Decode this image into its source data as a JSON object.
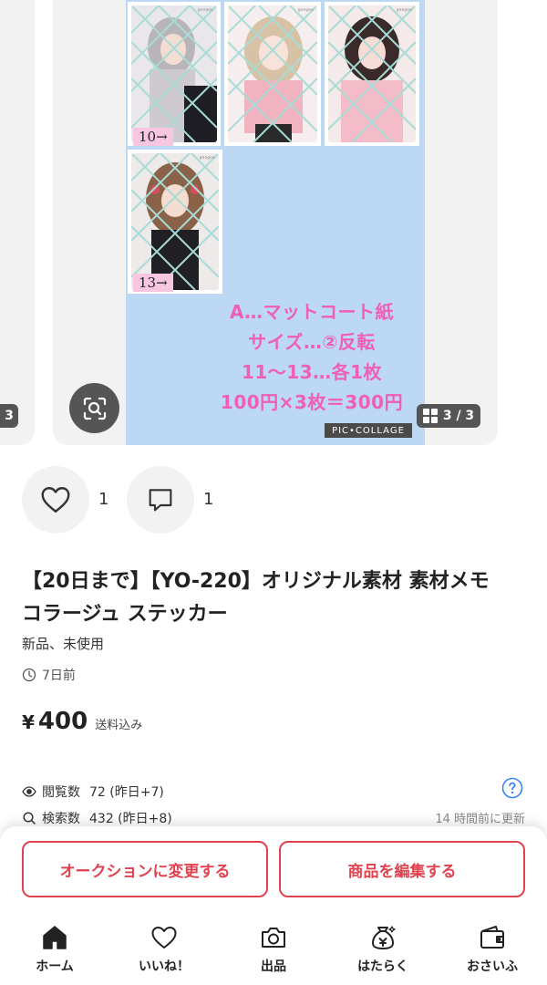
{
  "carousel": {
    "prev_counter": "3",
    "page_counter": "3 / 3",
    "collage": {
      "tags": [
        "10→",
        "13→"
      ],
      "caption_lines": [
        "A…マットコート紙",
        "サイズ…②反転",
        "11〜13…各1枚",
        "100円×3枚＝300円"
      ],
      "logo": "PIC•COLLAGE"
    }
  },
  "reactions": {
    "likes": "1",
    "comments": "1"
  },
  "product": {
    "title_line1": "【20日まで】【YO-220】オリジナル素材 素材メモ",
    "title_line2": "コラージュ ステッカー",
    "condition": "新品、未使用",
    "posted": "7日前",
    "currency": "¥",
    "price": "400",
    "shipping": "送料込み"
  },
  "stats": {
    "views_label": "閲覧数",
    "views_value": "72 (昨日+7)",
    "search_label": "検索数",
    "search_value": "432 (昨日+8)",
    "updated": "14 時間前に更新"
  },
  "actions": {
    "auction_label": "オークションに変更する",
    "edit_label": "商品を編集する"
  },
  "tabs": [
    {
      "label": "ホーム",
      "icon": "home-icon"
    },
    {
      "label": "いいね！",
      "icon": "heart-icon"
    },
    {
      "label": "出品",
      "icon": "camera-icon"
    },
    {
      "label": "はたらく",
      "icon": "money-bag-icon"
    },
    {
      "label": "おさいふ",
      "icon": "wallet-icon"
    }
  ],
  "colors": {
    "accent": "#e0434f",
    "caption_pink": "#ef5fb7",
    "collage_blue": "#bcd8f2"
  }
}
